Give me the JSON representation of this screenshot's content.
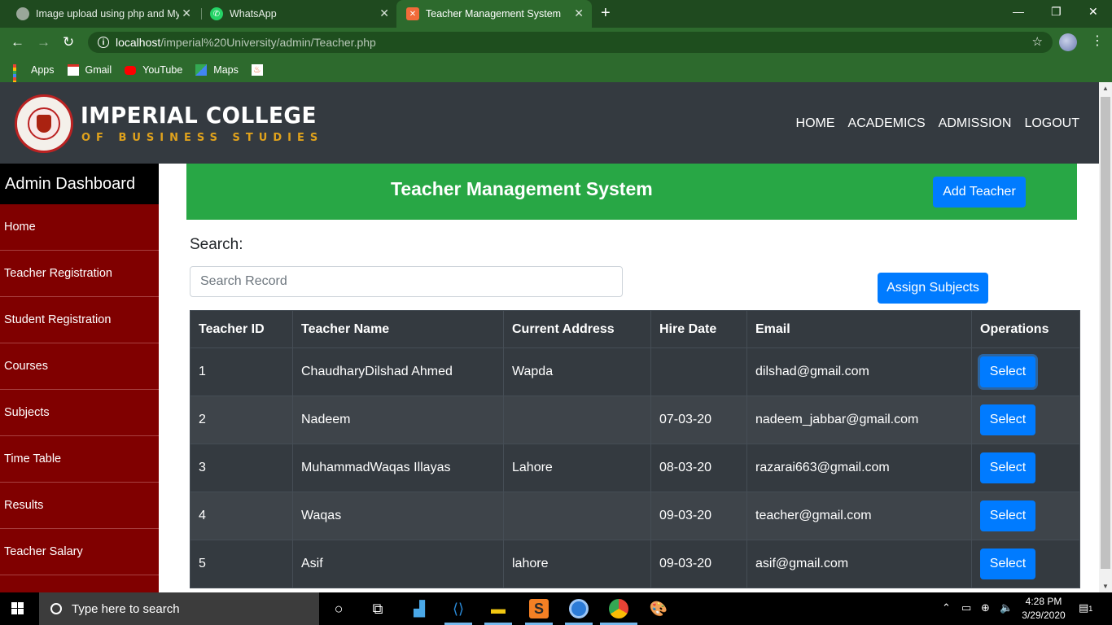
{
  "browser": {
    "tabs": [
      {
        "title": "Image upload using php and My",
        "active": false
      },
      {
        "title": "WhatsApp",
        "active": false
      },
      {
        "title": "Teacher Management System",
        "active": true
      }
    ],
    "url_host": "localhost",
    "url_path": "/imperial%20University/admin/Teacher.php",
    "bookmarks": [
      "Apps",
      "Gmail",
      "YouTube",
      "Maps"
    ]
  },
  "header": {
    "brand_line1": "IMPERIAL COLLEGE",
    "brand_line2": "OF BUSINESS STUDIES",
    "nav": [
      "HOME",
      "ACADEMICS",
      "ADMISSION",
      "LOGOUT"
    ]
  },
  "sidebar": {
    "title": "Admin Dashboard",
    "items": [
      "Home",
      "Teacher Registration",
      "Student Registration",
      "Courses",
      "Subjects",
      "Time Table",
      "Results",
      "Teacher Salary"
    ]
  },
  "main": {
    "banner_title": "Teacher Management System",
    "add_button": "Add Teacher",
    "search_label": "Search:",
    "search_placeholder": "Search Record",
    "assign_button": "Assign Subjects",
    "table": {
      "headers": [
        "Teacher ID",
        "Teacher Name",
        "Current Address",
        "Hire Date",
        "Email",
        "Operations"
      ],
      "rows": [
        {
          "id": "1",
          "name": "ChaudharyDilshad Ahmed",
          "address": "Wapda",
          "hire_date": "",
          "email": "dilshad@gmail.com",
          "action": "Select"
        },
        {
          "id": "2",
          "name": "Nadeem",
          "address": "",
          "hire_date": "07-03-20",
          "email": "nadeem_jabbar@gmail.com",
          "action": "Select"
        },
        {
          "id": "3",
          "name": "MuhammadWaqas Illayas",
          "address": "Lahore",
          "hire_date": "08-03-20",
          "email": "razarai663@gmail.com",
          "action": "Select"
        },
        {
          "id": "4",
          "name": "Waqas",
          "address": "",
          "hire_date": "09-03-20",
          "email": "teacher@gmail.com",
          "action": "Select"
        },
        {
          "id": "5",
          "name": "Asif",
          "address": "lahore",
          "hire_date": "09-03-20",
          "email": "asif@gmail.com",
          "action": "Select"
        }
      ]
    }
  },
  "taskbar": {
    "search_placeholder": "Type here to search",
    "time": "4:28 PM",
    "date": "3/29/2020",
    "notification_count": "1"
  },
  "colors": {
    "chrome_green": "#2d6a2d",
    "header_dark": "#343a40",
    "sidebar_maroon": "#800000",
    "banner_green": "#28a745",
    "button_blue": "#007bff",
    "brand_gold": "#e0a21c"
  }
}
